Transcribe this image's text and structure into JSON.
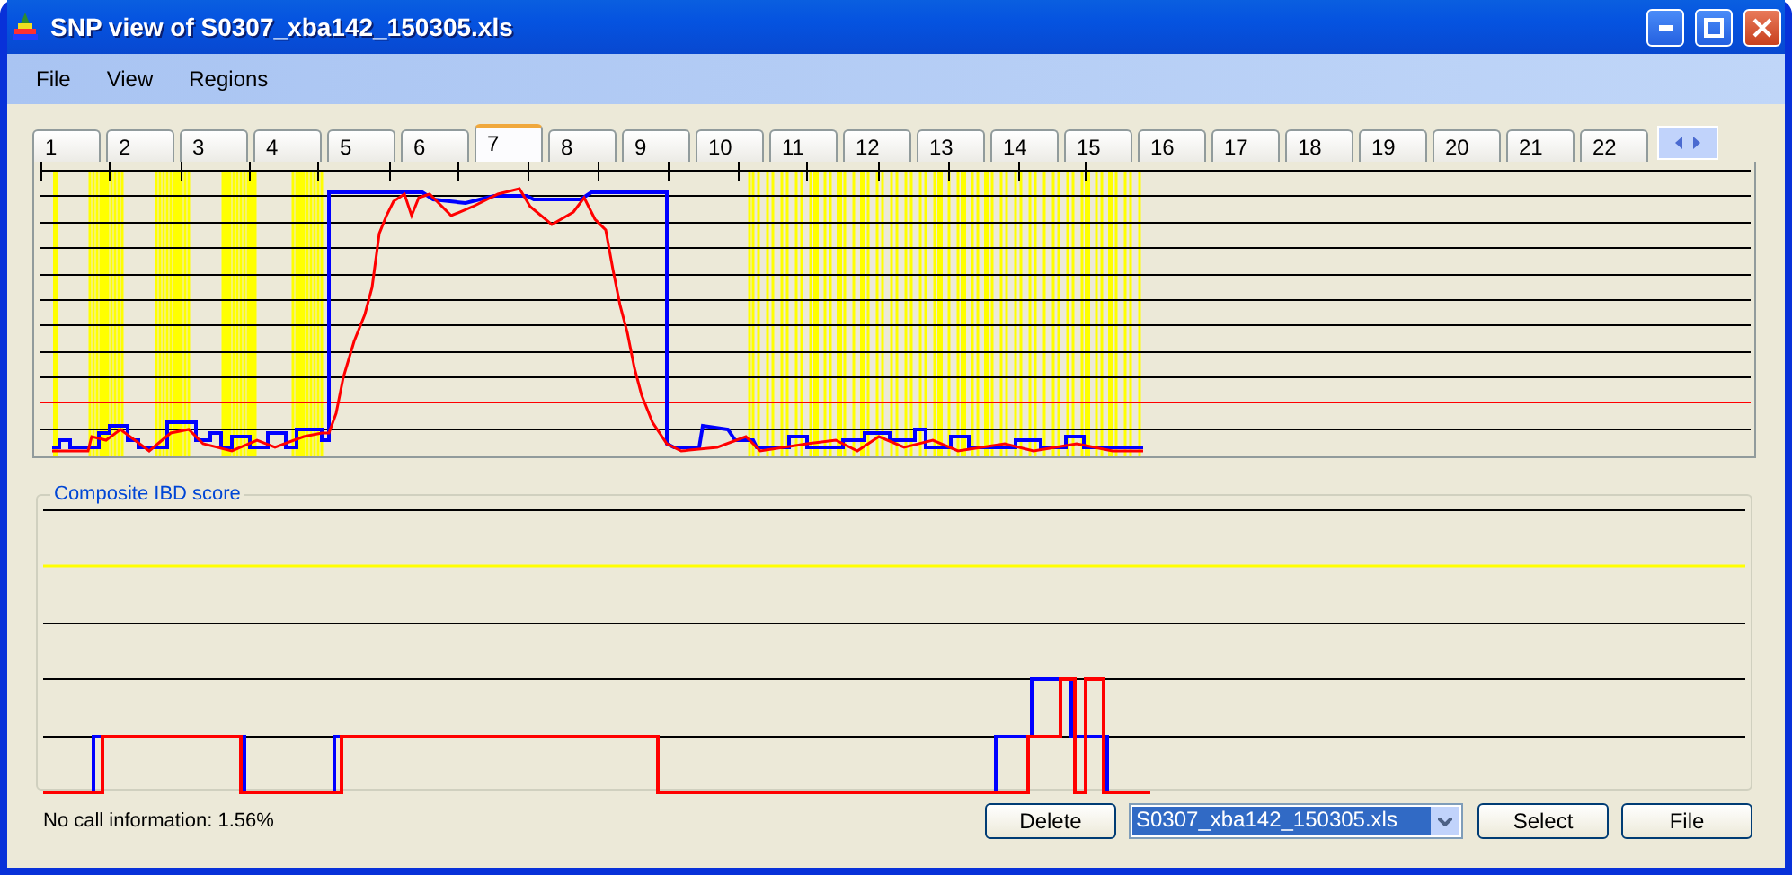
{
  "window": {
    "title": "SNP view of S0307_xba142_150305.xls"
  },
  "menu": [
    "File",
    "View",
    "Regions"
  ],
  "tabs": [
    {
      "label": "1",
      "selected": false
    },
    {
      "label": "2",
      "selected": false
    },
    {
      "label": "3",
      "selected": false
    },
    {
      "label": "4",
      "selected": false
    },
    {
      "label": "5",
      "selected": false
    },
    {
      "label": "6",
      "selected": false
    },
    {
      "label": "7",
      "selected": true
    },
    {
      "label": "8",
      "selected": false
    },
    {
      "label": "9",
      "selected": false
    },
    {
      "label": "10",
      "selected": false
    },
    {
      "label": "11",
      "selected": false
    },
    {
      "label": "12",
      "selected": false
    },
    {
      "label": "13",
      "selected": false
    },
    {
      "label": "14",
      "selected": false
    },
    {
      "label": "15",
      "selected": false
    },
    {
      "label": "16",
      "selected": false
    },
    {
      "label": "17",
      "selected": false
    },
    {
      "label": "18",
      "selected": false
    },
    {
      "label": "19",
      "selected": false
    },
    {
      "label": "20",
      "selected": false
    },
    {
      "label": "21",
      "selected": false
    },
    {
      "label": "22",
      "selected": false
    }
  ],
  "composite_panel": {
    "label": "Composite IBD score"
  },
  "status": "No call information: 1.56%",
  "buttons": {
    "delete": "Delete",
    "select": "Select",
    "file": "File"
  },
  "file_dropdown": {
    "value": "S0307_xba142_150305.xls"
  }
}
